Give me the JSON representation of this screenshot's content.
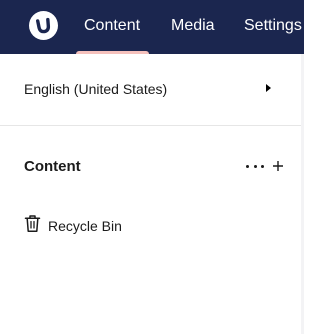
{
  "topbar": {
    "logo_icon": "umbraco-logo-icon",
    "tabs": [
      {
        "label": "Content",
        "active": true
      },
      {
        "label": "Media",
        "active": false
      },
      {
        "label": "Settings",
        "active": false
      }
    ],
    "background_color": "#1b264f",
    "active_indicator_color": "#f5c1bc"
  },
  "sidebar": {
    "language_selector": {
      "label": "English (United States)",
      "icon": "caret-right-icon"
    },
    "section": {
      "title": "Content",
      "more_icon": "ellipsis-icon",
      "add_icon": "plus-icon"
    },
    "items": [
      {
        "label": "Recycle Bin",
        "icon": "trash-icon"
      }
    ]
  }
}
